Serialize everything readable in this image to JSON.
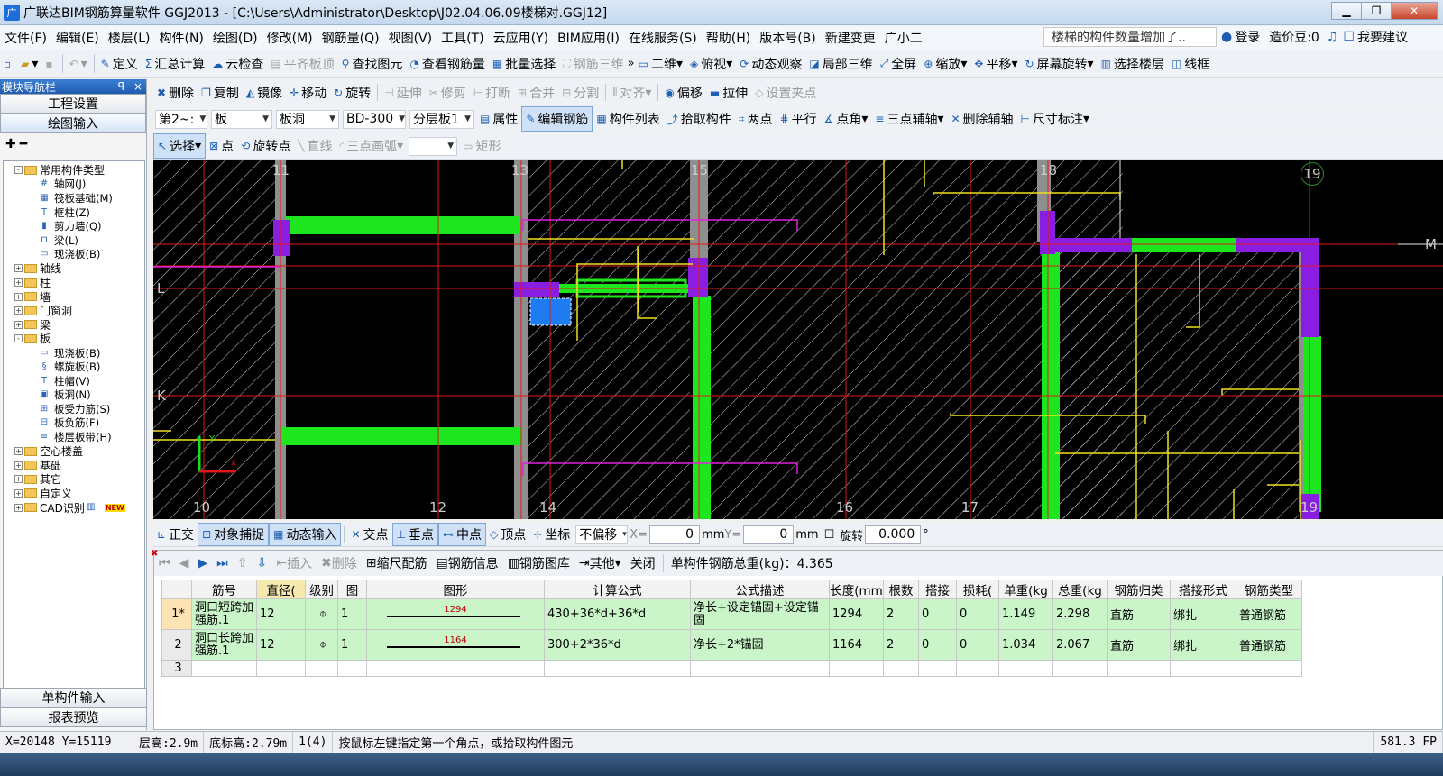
{
  "window": {
    "title": "广联达BIM钢筋算量软件 GGJ2013 - [C:\\Users\\Administrator\\Desktop\\J02.04.06.09楼梯对.GGJ12]",
    "app_icon": "广"
  },
  "menu": [
    "文件(F)",
    "编辑(E)",
    "楼层(L)",
    "构件(N)",
    "绘图(D)",
    "修改(M)",
    "钢筋量(Q)",
    "视图(V)",
    "工具(T)",
    "云应用(Y)",
    "BIM应用(I)",
    "在线服务(S)",
    "帮助(H)",
    "版本号(B)",
    "新建变更",
    "广小二"
  ],
  "banner": "楼梯的构件数量增加了..",
  "account": {
    "login": "登录",
    "coins": "造价豆:0",
    "suggest": "我要建议"
  },
  "toolbar1": [
    "定义",
    "汇总计算",
    "云检查",
    "平齐板顶",
    "查找图元",
    "查看钢筋量",
    "批量选择",
    "钢筋三维",
    "二维",
    "俯视",
    "动态观察",
    "局部三维",
    "全屏",
    "缩放",
    "平移",
    "屏幕旋转",
    "选择楼层",
    "线框"
  ],
  "toolbar2": [
    "删除",
    "复制",
    "镜像",
    "移动",
    "旋转",
    "延伸",
    "修剪",
    "打断",
    "合并",
    "分割",
    "对齐",
    "偏移",
    "拉伸",
    "设置夹点"
  ],
  "toolbar3": {
    "floor": "第2~:",
    "type": "板",
    "subtype": "板洞",
    "name": "BD-300",
    "layer": "分层板1",
    "btns": [
      "属性",
      "编辑钢筋",
      "构件列表",
      "拾取构件",
      "两点",
      "平行",
      "点角",
      "三点辅轴",
      "删除辅轴",
      "尺寸标注"
    ]
  },
  "toolbar4": [
    "选择",
    "点",
    "旋转点",
    "直线",
    "三点画弧",
    "矩形"
  ],
  "sidebar": {
    "title": "模块导航栏",
    "pin": "ꟼ",
    "close": "×",
    "btn_eng": "工程设置",
    "btn_draw": "绘图输入",
    "btn_single": "单构件输入",
    "btn_report": "报表预览",
    "tree": [
      {
        "lvl": 1,
        "exp": "-",
        "label": "常用构件类型"
      },
      {
        "lvl": 2,
        "ic": "#",
        "label": "轴网(J)"
      },
      {
        "lvl": 2,
        "ic": "▦",
        "label": "筏板基础(M)"
      },
      {
        "lvl": 2,
        "ic": "T",
        "label": "框柱(Z)"
      },
      {
        "lvl": 2,
        "ic": "▮",
        "label": "剪力墙(Q)"
      },
      {
        "lvl": 2,
        "ic": "⊓",
        "label": "梁(L)"
      },
      {
        "lvl": 2,
        "ic": "▭",
        "label": "现浇板(B)"
      },
      {
        "lvl": 1,
        "exp": "+",
        "label": "轴线"
      },
      {
        "lvl": 1,
        "exp": "+",
        "label": "柱"
      },
      {
        "lvl": 1,
        "exp": "+",
        "label": "墙"
      },
      {
        "lvl": 1,
        "exp": "+",
        "label": "门窗洞"
      },
      {
        "lvl": 1,
        "exp": "+",
        "label": "梁"
      },
      {
        "lvl": 1,
        "exp": "-",
        "label": "板"
      },
      {
        "lvl": 2,
        "ic": "▭",
        "label": "现浇板(B)"
      },
      {
        "lvl": 2,
        "ic": "§",
        "label": "螺旋板(B)"
      },
      {
        "lvl": 2,
        "ic": "T",
        "label": "柱帽(V)"
      },
      {
        "lvl": 2,
        "ic": "▣",
        "label": "板洞(N)"
      },
      {
        "lvl": 2,
        "ic": "⊞",
        "label": "板受力筋(S)"
      },
      {
        "lvl": 2,
        "ic": "⊟",
        "label": "板负筋(F)"
      },
      {
        "lvl": 2,
        "ic": "≡",
        "label": "楼层板带(H)"
      },
      {
        "lvl": 1,
        "exp": "+",
        "label": "空心楼盖"
      },
      {
        "lvl": 1,
        "exp": "+",
        "label": "基础"
      },
      {
        "lvl": 1,
        "exp": "+",
        "label": "其它"
      },
      {
        "lvl": 1,
        "exp": "+",
        "label": "自定义"
      },
      {
        "lvl": 1,
        "exp": "+",
        "label": "CAD识别",
        "new": "NEW"
      }
    ]
  },
  "canvas": {
    "axes_v": [
      "11",
      "13",
      "15",
      "18",
      "19"
    ],
    "axes_b": [
      "10",
      "12",
      "14",
      "16",
      "17",
      "19"
    ],
    "axes_h": [
      "L",
      "K",
      "M"
    ]
  },
  "snapbar": {
    "btns": [
      "正交",
      "对象捕捉",
      "动态输入",
      "交点",
      "垂点",
      "中点",
      "顶点",
      "坐标"
    ],
    "offset": "不偏移",
    "x_label": "X=",
    "x": "0",
    "mm1": "mm",
    "y_label": "Y=",
    "y": "0",
    "mm2": "mm",
    "rot_label": "旋转",
    "rot": "0.000",
    "deg": "°"
  },
  "gridtb": {
    "btns": [
      "插入",
      "删除",
      "缩尺配筋",
      "钢筋信息",
      "钢筋图库",
      "其他",
      "关闭"
    ],
    "total": "单构件钢筋总重(kg)：4.365"
  },
  "table": {
    "headers": [
      "筋号",
      "直径(",
      "级别",
      "图",
      "图形",
      "计算公式",
      "公式描述",
      "长度(mm",
      "根数",
      "搭接",
      "损耗(",
      "单重(kg",
      "总重(kg",
      "钢筋归类",
      "搭接形式",
      "钢筋类型"
    ],
    "rows": [
      {
        "rh": "1*",
        "name": "洞口短跨加强筋.1",
        "dia": "12",
        "grade": "⌽",
        "fig": "1",
        "shape": "1294",
        "formula": "430+36*d+36*d",
        "desc": "净长+设定锚固+设定锚固",
        "len": "1294",
        "count": "2",
        "lap": "0",
        "loss": "0",
        "unit": "1.149",
        "total": "2.298",
        "cat": "直筋",
        "lapform": "绑扎",
        "type": "普通钢筋"
      },
      {
        "rh": "2",
        "name": "洞口长跨加强筋.1",
        "dia": "12",
        "grade": "⌽",
        "fig": "1",
        "shape": "1164",
        "formula": "300+2*36*d",
        "desc": "净长+2*锚固",
        "len": "1164",
        "count": "2",
        "lap": "0",
        "loss": "0",
        "unit": "1.034",
        "total": "2.067",
        "cat": "直筋",
        "lapform": "绑扎",
        "type": "普通钢筋"
      }
    ],
    "empty_rh": "3"
  },
  "status": {
    "coords": "X=20148 Y=15119",
    "floor_h": "层高:2.9m",
    "base_h": "底标高:2.79m",
    "count": "1(4)",
    "hint": "按鼠标左键指定第一个角点，或拾取构件图元",
    "fps": "581.3 FP"
  }
}
